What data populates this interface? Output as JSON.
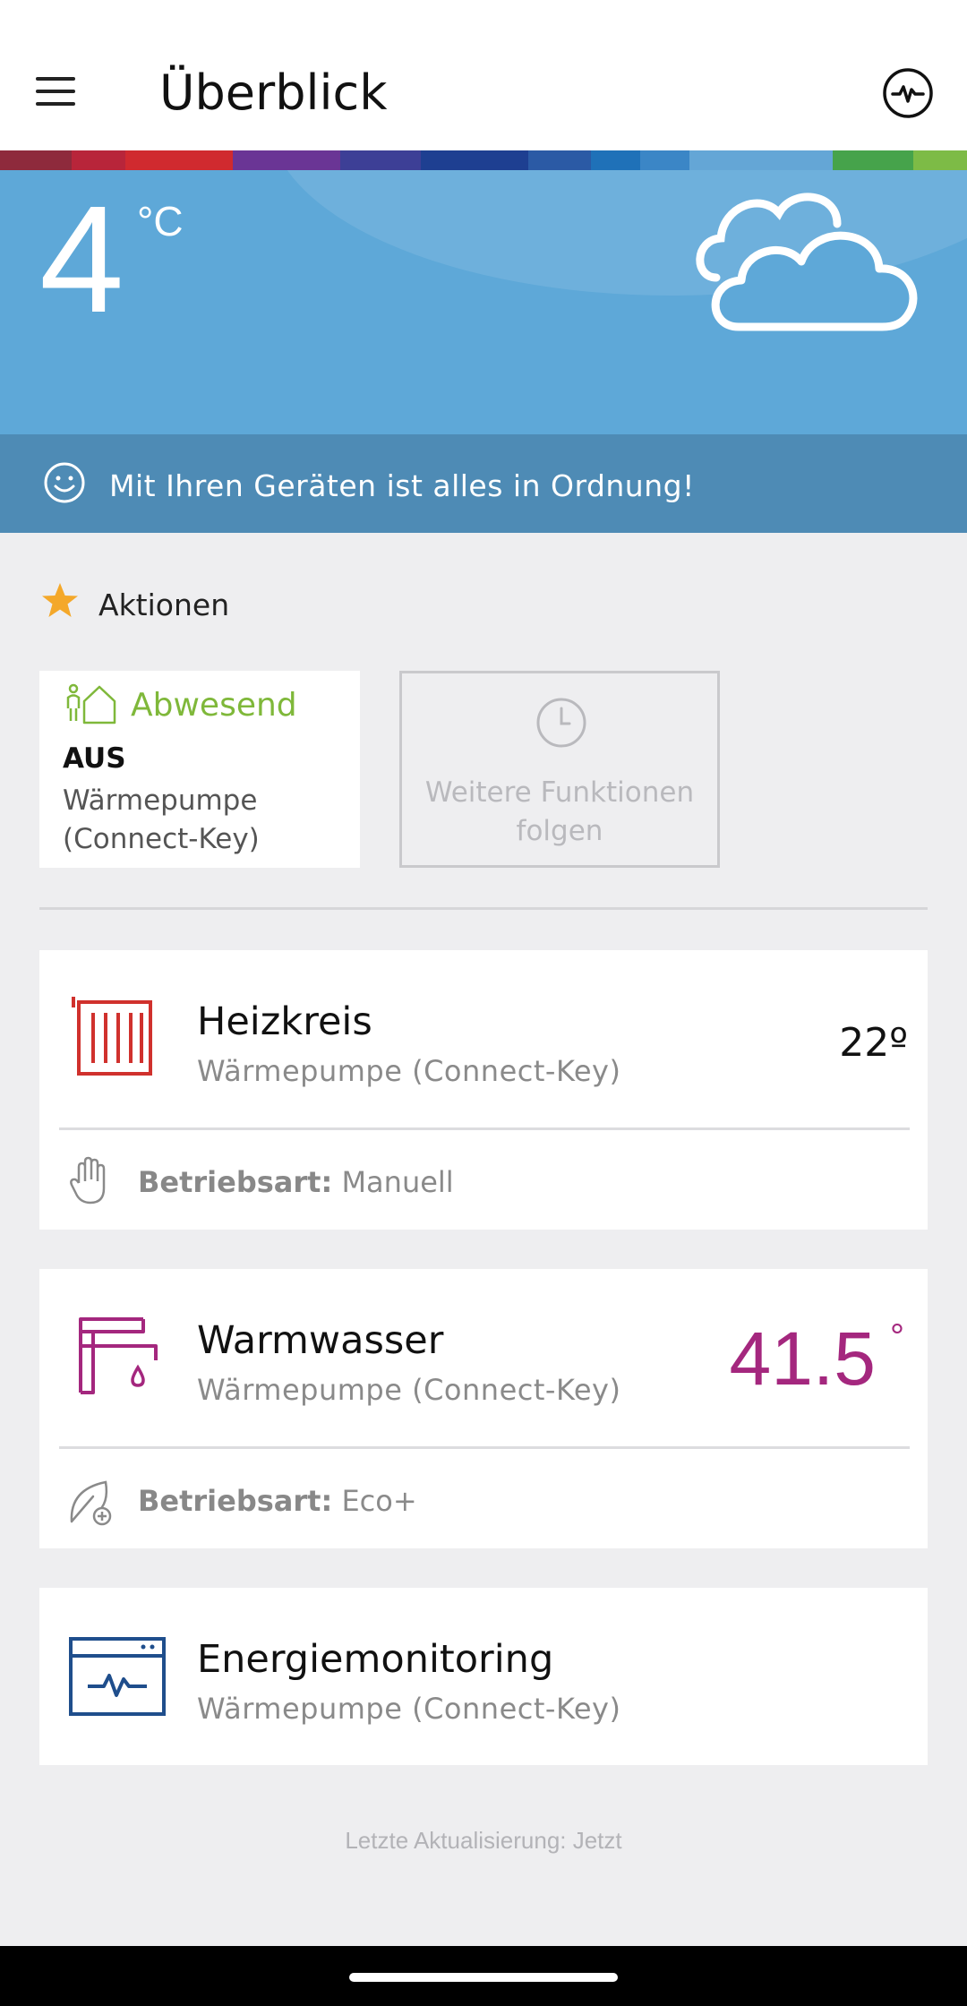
{
  "header": {
    "title": "Überblick",
    "menu_icon": "hamburger-menu-icon",
    "right_icon": "activity-pulse-icon"
  },
  "weather": {
    "temperature": "4",
    "unit": "°C",
    "condition_icon": "cloud-icon",
    "background_color": "#5ea8d8"
  },
  "status": {
    "icon": "smiley-icon",
    "text": "Mit Ihren Geräten ist alles in Ordnung!"
  },
  "actions": {
    "label": "Aktionen",
    "icon": "star-icon",
    "absent": {
      "title": "Abwesend",
      "state": "AUS",
      "device": "Wärmepumpe (Connect-Key)",
      "accent_color": "#7fb83a"
    },
    "more": {
      "text": "Weitere Funktionen folgen",
      "icon": "clock-icon"
    }
  },
  "cards": {
    "heating": {
      "title": "Heizkreis",
      "device": "Wärmepumpe (Connect-Key)",
      "value": "22º",
      "mode_label": "Betriebsart:",
      "mode_value": "Manuell",
      "icon": "radiator-icon",
      "mode_icon": "hand-icon",
      "accent_color": "#d0312d"
    },
    "water": {
      "title": "Warmwasser",
      "device": "Wärmepumpe (Connect-Key)",
      "value": "41.5",
      "degree": "°",
      "mode_label": "Betriebsart:",
      "mode_value": "Eco+",
      "icon": "faucet-icon",
      "mode_icon": "eco-leaf-icon",
      "accent_color": "#a4277e"
    },
    "energy": {
      "title": "Energiemonitoring",
      "device": "Wärmepumpe (Connect-Key)",
      "icon": "energy-monitor-icon",
      "accent_color": "#1f4e8c"
    }
  },
  "footer": {
    "last_update": "Letzte Aktualisierung: Jetzt"
  }
}
